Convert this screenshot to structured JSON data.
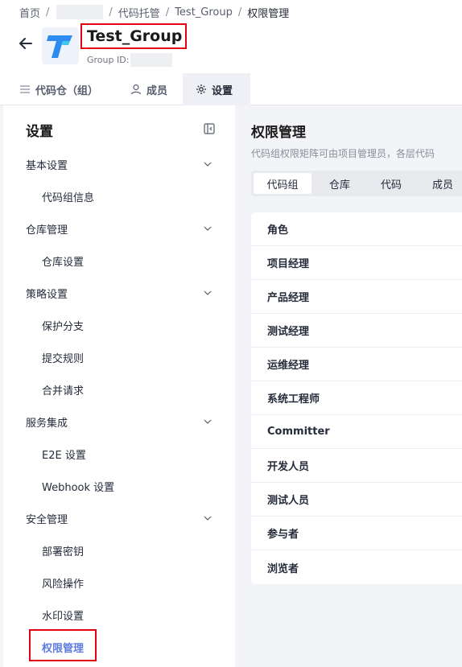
{
  "breadcrumb": {
    "home": "首页",
    "sep": "/",
    "code_hosting": "代码托管",
    "group": "Test_Group",
    "current": "权限管理"
  },
  "header": {
    "title": "Test_Group",
    "group_id_label": "Group ID:"
  },
  "tabs": [
    {
      "label": "代码仓（组）",
      "icon": "list-icon"
    },
    {
      "label": "成员",
      "icon": "user-icon"
    },
    {
      "label": "设置",
      "icon": "gear-icon"
    }
  ],
  "sidebar": {
    "title": "设置",
    "sections": [
      {
        "label": "基本设置",
        "items": [
          "代码组信息"
        ]
      },
      {
        "label": "仓库管理",
        "items": [
          "仓库设置"
        ]
      },
      {
        "label": "策略设置",
        "items": [
          "保护分支",
          "提交规则",
          "合并请求"
        ]
      },
      {
        "label": "服务集成",
        "items": [
          "E2E 设置",
          "Webhook 设置"
        ]
      },
      {
        "label": "安全管理",
        "items": [
          "部署密钥",
          "风险操作",
          "水印设置",
          "权限管理"
        ]
      }
    ],
    "active_item": "权限管理"
  },
  "main": {
    "title": "权限管理",
    "description": "代码组权限矩阵可由项目管理员，各层代码",
    "segments": [
      "代码组",
      "仓库",
      "代码",
      "成员"
    ],
    "active_segment": "代码组",
    "table": {
      "header": "角色",
      "rows": [
        "项目经理",
        "产品经理",
        "测试经理",
        "运维经理",
        "系统工程师",
        "Committer",
        "开发人员",
        "测试人员",
        "参与者",
        "浏览者"
      ]
    }
  },
  "colors": {
    "accent": "#5e7ce0",
    "highlight_box": "#e3000f",
    "logo_blue": "#2d8cf0",
    "logo_cyan": "#3dc7e8"
  }
}
